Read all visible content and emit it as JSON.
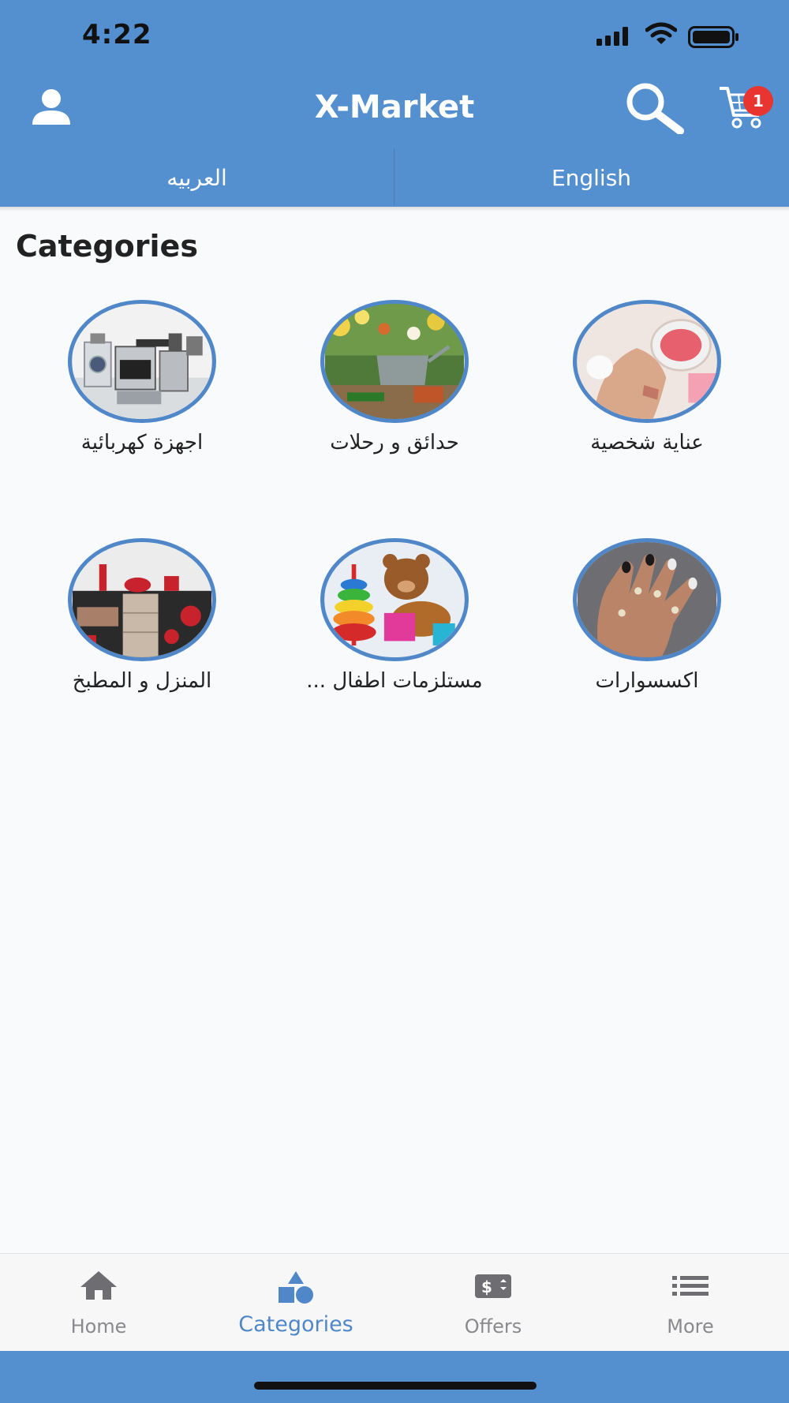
{
  "status_bar": {
    "time": "4:22"
  },
  "header": {
    "title": "X-Market",
    "cart_count": "1"
  },
  "language": {
    "arabic": "العربيه",
    "english": "English"
  },
  "section_title": "Categories",
  "categories": [
    {
      "label": "اجهزة كهربائية",
      "image": "electrical-appliances-image"
    },
    {
      "label": "حدائق و رحلات",
      "image": "garden-image"
    },
    {
      "label": "عناية شخصية",
      "image": "personal-care-image"
    },
    {
      "label": "المنزل و المطبخ",
      "image": "kitchen-image"
    },
    {
      "label": "مستلزمات اطفال ...",
      "image": "kids-toys-image"
    },
    {
      "label": "اكسسوارات",
      "image": "accessories-image"
    }
  ],
  "tabbar": {
    "active": "Categories",
    "items": [
      {
        "label": "Home",
        "icon": "home-icon"
      },
      {
        "label": "Categories",
        "icon": "shapes-icon"
      },
      {
        "label": "Offers",
        "icon": "dollar-tag-icon"
      },
      {
        "label": "More",
        "icon": "list-icon"
      }
    ]
  },
  "colors": {
    "header": "#5490cf",
    "accent": "#4f87c8",
    "badge": "#e8352f",
    "background": "#f9fafc"
  }
}
